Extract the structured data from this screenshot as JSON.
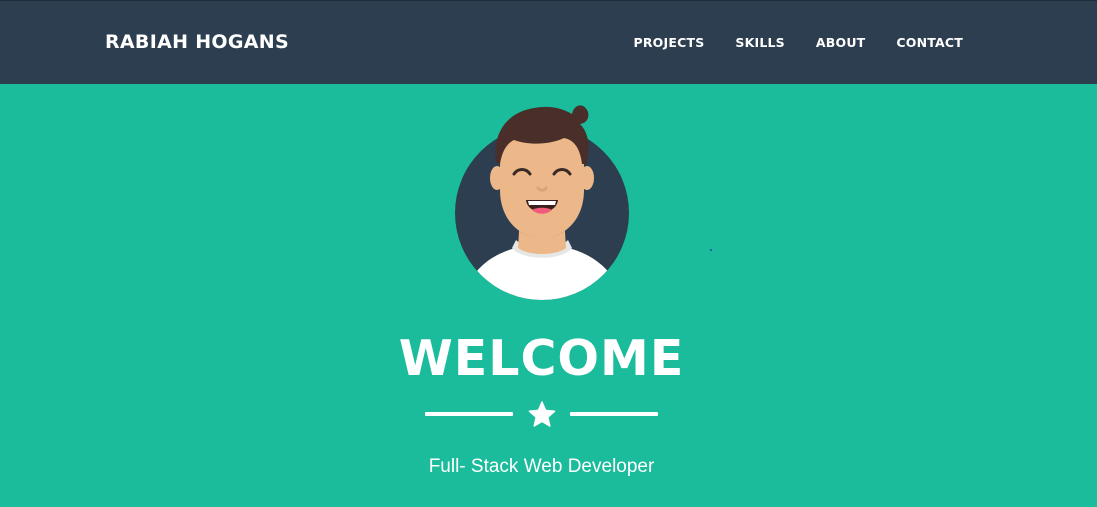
{
  "navbar": {
    "brand": "RABIAH HOGANS",
    "links": [
      {
        "label": "PROJECTS"
      },
      {
        "label": "SKILLS"
      },
      {
        "label": "ABOUT"
      },
      {
        "label": "CONTACT"
      }
    ]
  },
  "hero": {
    "title": "WELCOME",
    "subtitle": "Full- Stack Web Developer",
    "avatar_icon": "avatar-illustration",
    "divider_icon": "star-icon"
  },
  "colors": {
    "navbar_bg": "#2c3e50",
    "hero_bg": "#1abc9c",
    "text": "#ffffff"
  }
}
